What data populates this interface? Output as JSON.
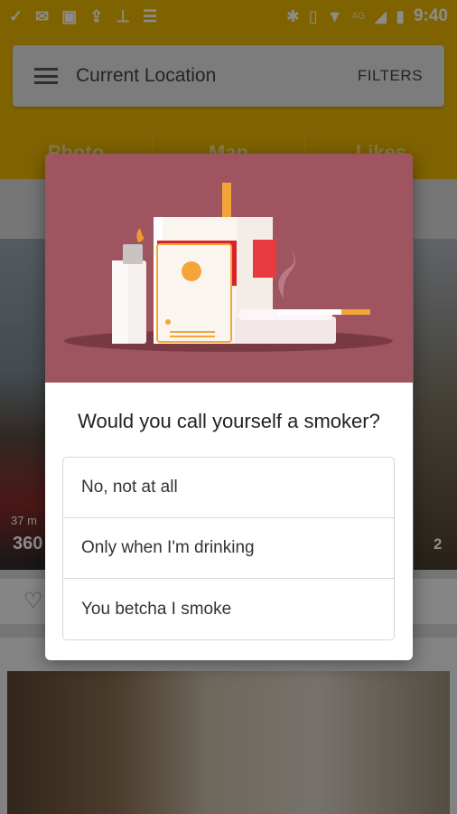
{
  "statusbar": {
    "time": "9:40",
    "network": "4G"
  },
  "header": {
    "title": "Current Location",
    "filters_label": "FILTERS"
  },
  "tabs": [
    {
      "label": "Photo"
    },
    {
      "label": "Map"
    },
    {
      "label": "Likes"
    }
  ],
  "background": {
    "distance": "37 m",
    "price": "360",
    "baths": "2"
  },
  "dialog": {
    "question": "Would you call yourself a smoker?",
    "options": [
      {
        "label": "No, not at all"
      },
      {
        "label": "Only when I'm drinking"
      },
      {
        "label": "You betcha I smoke"
      }
    ]
  },
  "colors": {
    "accent": "#e8b400",
    "illustration_bg": "#9e5560",
    "pack_red": "#d8232a"
  }
}
